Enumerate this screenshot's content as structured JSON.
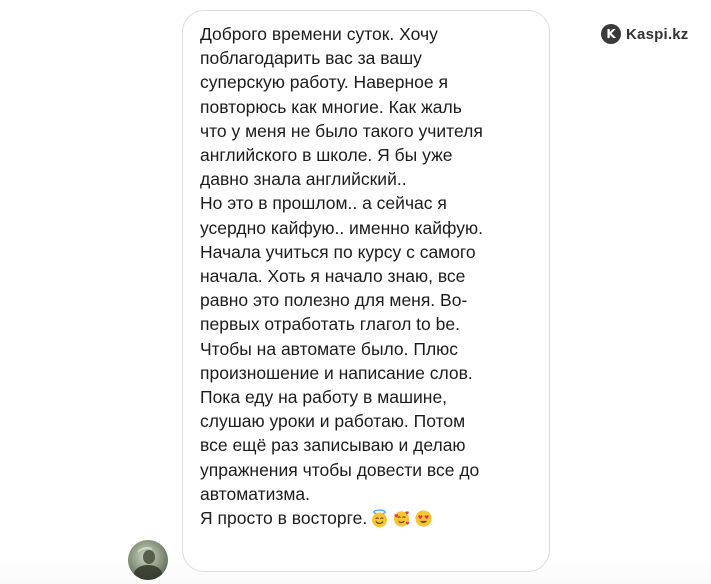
{
  "watermark": {
    "text": "Kaspi.kz",
    "icon": "kaspi-logo-icon"
  },
  "message": {
    "lines": [
      "Доброго времени суток. Хочу",
      "поблагодарить вас за вашу",
      "суперскую работу. Наверное я",
      "повторюсь как многие. Как жаль",
      "что у меня не было такого учителя",
      "английского в школе. Я бы уже",
      "давно знала английский..",
      "Но это в прошлом.. а сейчас я",
      "усердно кайфую.. именно кайфую.",
      "Начала учиться по курсу с самого",
      "начала. Хоть я начало знаю, все",
      "равно это полезно для меня. Во-",
      "первых отработать глагол to be.",
      "Чтобы на автомате было. Плюс",
      "произношение и написание слов.",
      "Пока еду на работу в машине,",
      "слушаю уроки и работаю. Потом",
      "все ещё раз записываю и делаю",
      "упражнения чтобы довести все до",
      "автоматизма.",
      "Я просто в восторге."
    ],
    "emojis": [
      "smiling-face-with-halo-icon",
      "smiling-face-with-hearts-icon",
      "heart-eyes-icon"
    ]
  },
  "sender": {
    "avatar": "avatar"
  }
}
